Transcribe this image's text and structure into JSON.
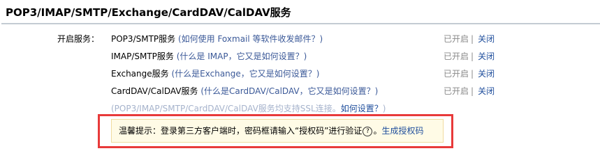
{
  "header": {
    "title": "POP3/IMAP/SMTP/Exchange/CardDAV/CalDAV服务"
  },
  "section_label": "开启服务：",
  "services": [
    {
      "name": "POP3/SMTP服务",
      "help_open": " (",
      "help_text": "如何使用 Foxmail 等软件收发邮件？",
      "help_close": ")",
      "status_on": "已开启",
      "sep": "|",
      "status_off": "关闭"
    },
    {
      "name": "IMAP/SMTP服务",
      "help_open": " (",
      "help_text": "什么是 IMAP，它又是如何设置？",
      "help_close": ")",
      "status_on": "已开启",
      "sep": "|",
      "status_off": "关闭"
    },
    {
      "name": "Exchange服务",
      "help_open": " (",
      "help_text": "什么是Exchange，它又是如何设置？",
      "help_close": ")",
      "status_on": "已开启",
      "sep": "|",
      "status_off": "关闭"
    },
    {
      "name": "CardDAV/CalDAV服务",
      "help_open": " (",
      "help_text": "什么是CardDAV/CalDAV，它又是如何设置？",
      "help_close": ")",
      "status_on": "已开启",
      "sep": "|",
      "status_off": "关闭"
    }
  ],
  "ssl_note": {
    "prefix": "(POP3/IMAP/SMTP/CardDAV/CalDAV服务均支持SSL连接。",
    "link": "如何设置？",
    "suffix": ")"
  },
  "tip": {
    "text": "温馨提示：登录第三方客户端时，密码框请输入“授权码”进行验证",
    "icon_glyph": "?",
    "dot": "。",
    "gen_link": "生成授权码"
  }
}
